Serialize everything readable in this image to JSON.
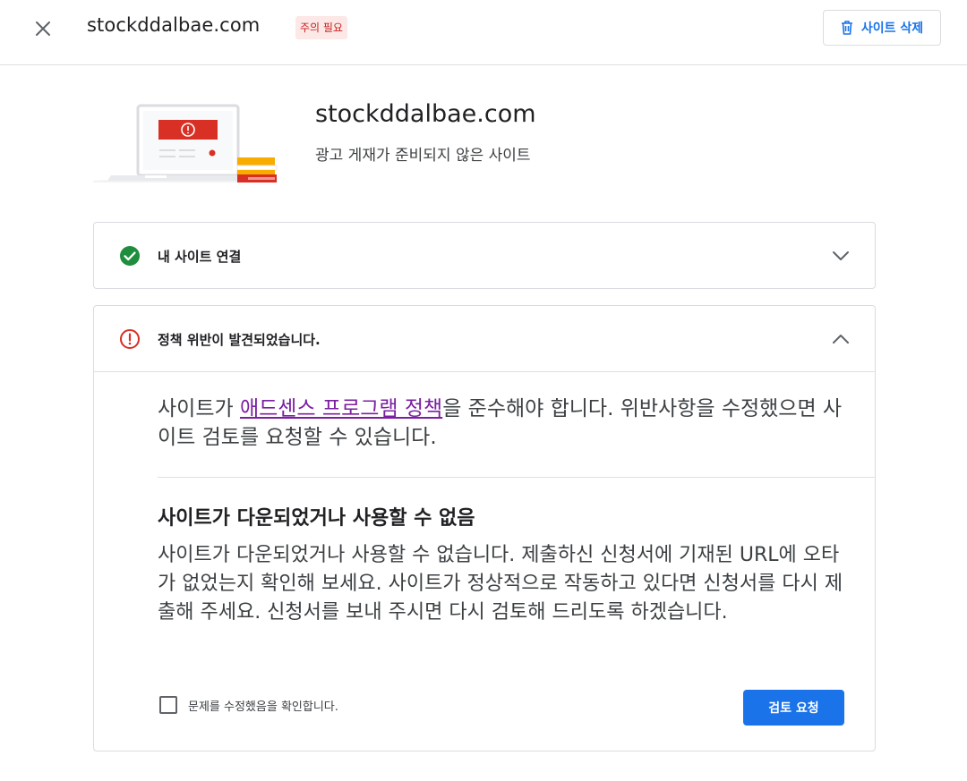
{
  "header": {
    "close_icon": "close-icon",
    "site_name": "stockddalbae.com",
    "status_badge": "주의 필요",
    "delete_button": {
      "icon": "trash-icon",
      "label": "사이트 삭제"
    }
  },
  "site": {
    "illustration": "laptop-warning-illustration",
    "name": "stockddalbae.com",
    "status": "광고 게재가 준비되지 않은 사이트"
  },
  "sections": {
    "connect": {
      "icon": "check-circle-icon",
      "title": "내 사이트 연결",
      "expanded": false
    },
    "policy": {
      "icon": "error-circle-icon",
      "title": "정책 위반이 발견되었습니다.",
      "expanded": true,
      "intro_before": "사이트가 ",
      "intro_link": "애드센스 프로그램 정책",
      "intro_after": "을 준수해야 합니다. 위반사항을 수정했으면 사이트 검토를 요청할 수 있습니다.",
      "issue_title": "사이트가 다운되었거나 사용할 수 없음",
      "issue_body": "사이트가 다운되었거나 사용할 수 없습니다. 제출하신 신청서에 기재된 URL에 오타가 없었는지 확인해 보세요. 사이트가 정상적으로 작동하고 있다면 신청서를 다시 제출해 주세요. 신청서를 보내 주시면 다시 검토해 드리도록 하겠습니다.",
      "confirm_label": "문제를 수정했음을 확인합니다.",
      "confirm_checked": false,
      "review_button": "검토 요청"
    }
  },
  "colors": {
    "primary": "#1a73e8",
    "success": "#1e8e3e",
    "error": "#d93025",
    "badge_bg": "#fce8e6",
    "link_visited": "#7b1fa2"
  }
}
